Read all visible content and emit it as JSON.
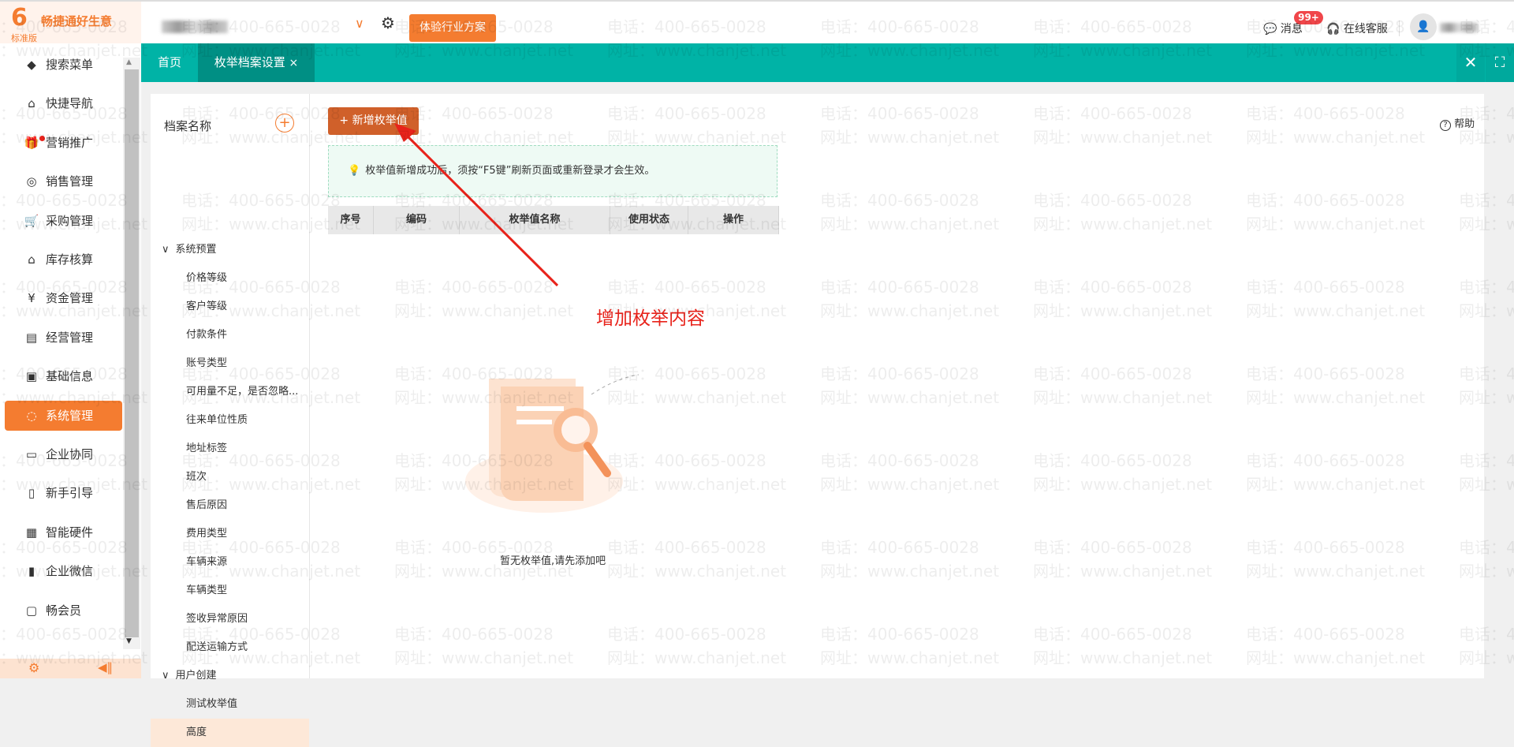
{
  "watermark": {
    "phone": "电话：400-665-0028",
    "site": "网址：www.chanjet.net"
  },
  "header": {
    "brand": "畅捷通好生意",
    "edition": "标准版",
    "trial_button": "体验行业方案",
    "messages": "消息",
    "badge": "99+",
    "support": "在线客服"
  },
  "tabs": [
    {
      "label": "首页"
    },
    {
      "label": "枚举档案设置",
      "close": "×"
    }
  ],
  "sidebar": {
    "items": [
      {
        "label": "搜索菜单",
        "icon": "gem-icon"
      },
      {
        "label": "快捷导航",
        "icon": "home-icon"
      },
      {
        "label": "营销推广",
        "icon": "gift-icon"
      },
      {
        "label": "销售管理",
        "icon": "sales-icon"
      },
      {
        "label": "采购管理",
        "icon": "cart-icon"
      },
      {
        "label": "库存核算",
        "icon": "warehouse-icon"
      },
      {
        "label": "资金管理",
        "icon": "money-bag-icon"
      },
      {
        "label": "经营管理",
        "icon": "clipboard-icon"
      },
      {
        "label": "基础信息",
        "icon": "id-card-icon"
      },
      {
        "label": "系统管理",
        "icon": "system-icon",
        "active": true
      },
      {
        "label": "企业协同",
        "icon": "monitor-icon"
      },
      {
        "label": "新手引导",
        "icon": "book-icon"
      },
      {
        "label": "智能硬件",
        "icon": "hardware-icon"
      },
      {
        "label": "企业微信",
        "icon": "wechat-work-icon"
      },
      {
        "label": "畅会员",
        "icon": "member-icon"
      }
    ]
  },
  "tree": {
    "title": "档案名称",
    "groups": [
      {
        "label": "系统预置",
        "children": [
          "价格等级",
          "客户等级",
          "付款条件",
          "账号类型",
          "可用量不足，是否忽略...",
          "往来单位性质",
          "地址标签",
          "班次",
          "售后原因",
          "费用类型",
          "车辆来源",
          "车辆类型",
          "签收异常原因",
          "配送运输方式"
        ]
      },
      {
        "label": "用户创建",
        "children": [
          "测试枚举值",
          "高度"
        ]
      }
    ],
    "selected": "高度"
  },
  "main": {
    "add_button": "+ 新增枚举值",
    "hint": "枚举值新增成功后，须按“F5键”刷新页面或重新登录才会生效。",
    "help": "帮助",
    "columns": [
      "序号",
      "编码",
      "枚举值名称",
      "使用状态",
      "操作"
    ],
    "empty_text": "暂无枚举值,请先添加吧",
    "annotation": "增加枚举内容"
  },
  "colors": {
    "teal": "#00b3a6",
    "orange": "#f47c30",
    "button": "#d0602a",
    "annotation": "#e8231b"
  }
}
